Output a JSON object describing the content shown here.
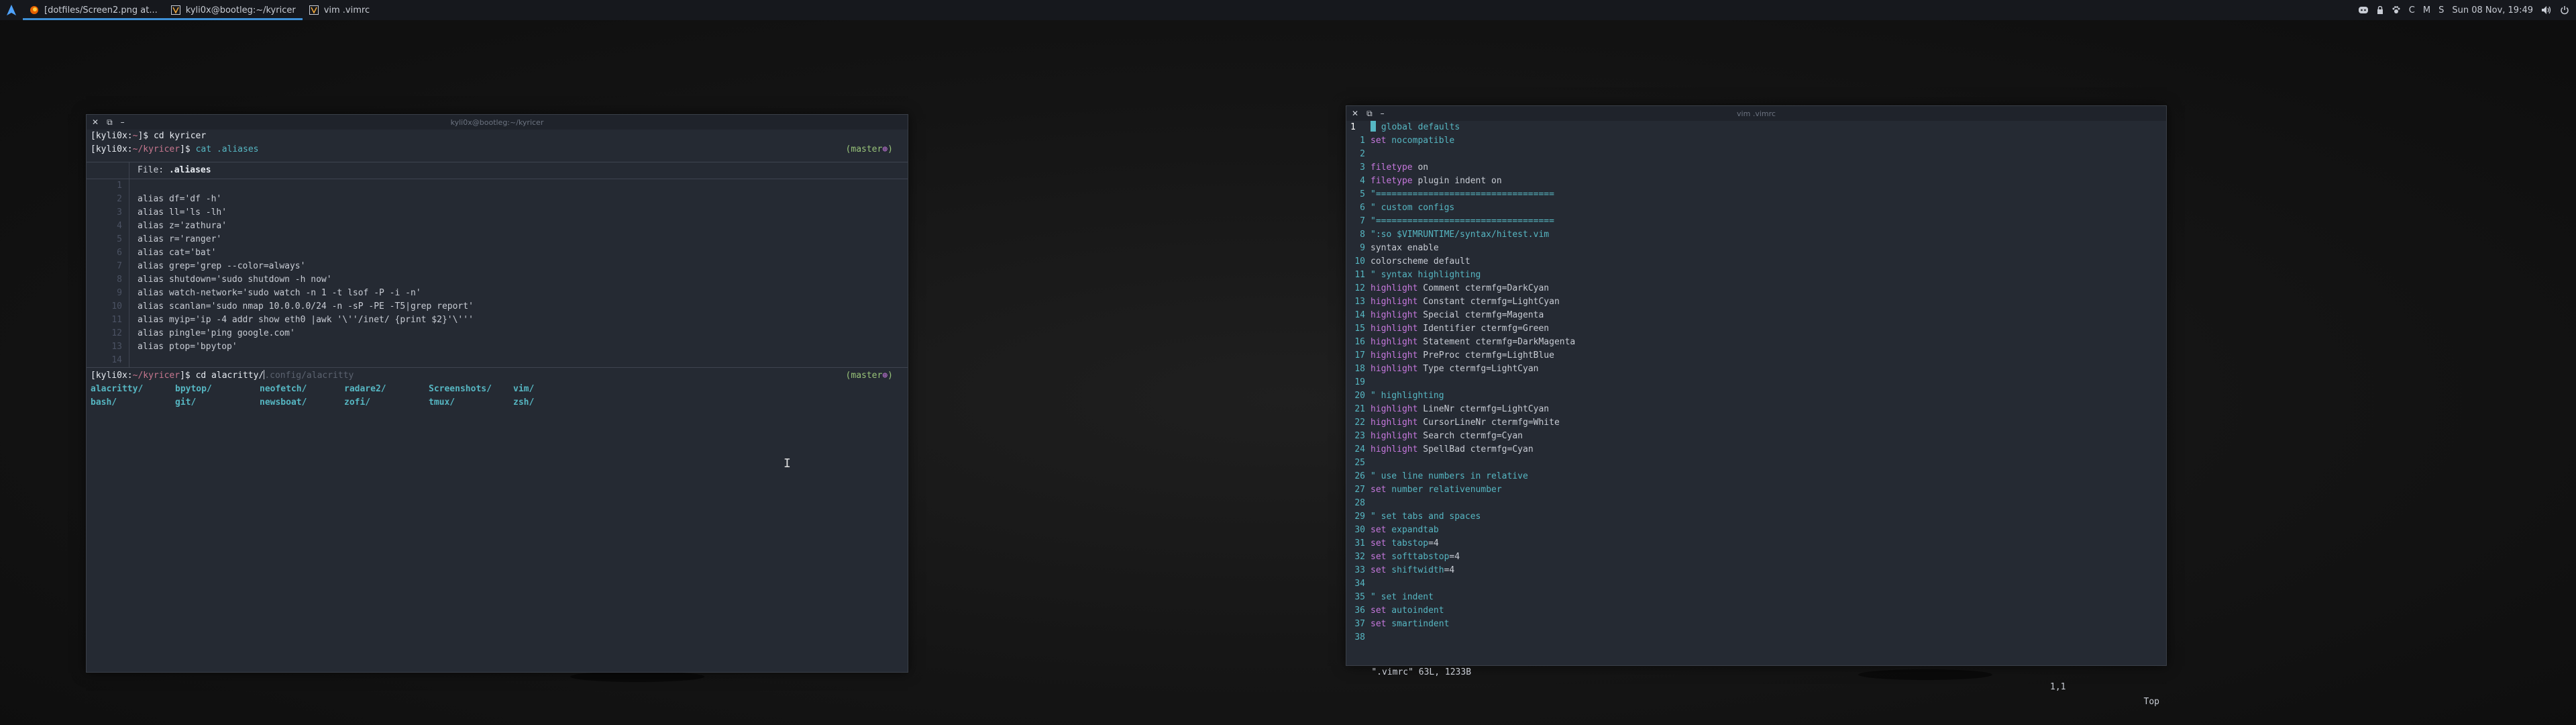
{
  "taskbar": {
    "tasks": [
      {
        "label": "[dotfiles/Screen2.png at...",
        "icon": "firefox-icon",
        "active": true
      },
      {
        "label": "kyli0x@bootleg:~/kyricer",
        "icon": "terminal-icon",
        "active": true
      },
      {
        "label": "vim .vimrc",
        "icon": "terminal-icon",
        "active": false
      }
    ],
    "tray": {
      "letters": [
        "C",
        "M",
        "S"
      ],
      "datetime": "Sun 08 Nov, 19:49"
    }
  },
  "left_terminal": {
    "title": "kyli0x@bootleg:~/kyricer",
    "buttons": [
      "✕",
      "⧉",
      "–"
    ],
    "prompt_user": "[kyli0x:",
    "prompt_tilde": "~",
    "prompt_kyricer": "~/kyricer",
    "prompt_end": "]$ ",
    "cmd1": "cd kyricer",
    "cmd2": "cat .aliases",
    "branch": "(master",
    "branch_mark": "⊕",
    "branch_close": ")",
    "bat_file_label": "File: ",
    "bat_file_name": ".aliases",
    "file_lines": [
      {
        "n": "1",
        "t": ""
      },
      {
        "n": "2",
        "t": "alias df='df -h'"
      },
      {
        "n": "3",
        "t": "alias ll='ls -lh'"
      },
      {
        "n": "4",
        "t": "alias z='zathura'"
      },
      {
        "n": "5",
        "t": "alias r='ranger'"
      },
      {
        "n": "6",
        "t": "alias cat='bat'"
      },
      {
        "n": "7",
        "t": "alias grep='grep --color=always'"
      },
      {
        "n": "8",
        "t": "alias shutdown='sudo shutdown -h now'"
      },
      {
        "n": "9",
        "t": "alias watch-network='sudo watch -n 1 -t lsof -P -i -n'"
      },
      {
        "n": "10",
        "t": "alias scanlan='sudo nmap 10.0.0.0/24 -n -sP -PE -T5|grep report'"
      },
      {
        "n": "11",
        "t": "alias myip='ip -4 addr show eth0 |awk '\\''/inet/ {print $2}'\\'''"
      },
      {
        "n": "12",
        "t": "alias pingle='ping google.com'"
      },
      {
        "n": "13",
        "t": "alias ptop='bpytop'"
      },
      {
        "n": "14",
        "t": ""
      }
    ],
    "cmd3_typed": "cd alacritty/",
    "cmd3_suggest": ".config/alacritty",
    "ls_items": [
      "alacritty/",
      "bpytop/",
      "neofetch/",
      "radare2/",
      "Screenshots/",
      "vim/",
      "bash/",
      "git/",
      "newsboat/",
      "zofi/",
      "tmux/",
      "zsh/"
    ]
  },
  "right_terminal": {
    "title": "vim .vimrc",
    "buttons": [
      "✕",
      "⧉",
      "–"
    ],
    "lines": [
      {
        "n": "1",
        "cur": true,
        "parts": [
          {
            "c": "vc",
            "t": " global defaults"
          }
        ]
      },
      {
        "n": "1",
        "parts": [
          {
            "c": "vk",
            "t": "set"
          },
          {
            "c": "vc",
            "t": " nocompatible"
          }
        ]
      },
      {
        "n": "2",
        "parts": []
      },
      {
        "n": "3",
        "parts": [
          {
            "c": "vk",
            "t": "filetype"
          },
          {
            "c": "",
            "t": " on"
          }
        ]
      },
      {
        "n": "4",
        "parts": [
          {
            "c": "vk",
            "t": "filetype"
          },
          {
            "c": "",
            "t": " plugin indent on"
          }
        ]
      },
      {
        "n": "5",
        "parts": [
          {
            "c": "vc",
            "t": "\"=================================="
          }
        ]
      },
      {
        "n": "6",
        "parts": [
          {
            "c": "vc",
            "t": "\" custom configs"
          }
        ]
      },
      {
        "n": "7",
        "parts": [
          {
            "c": "vc",
            "t": "\"=================================="
          }
        ]
      },
      {
        "n": "8",
        "parts": [
          {
            "c": "vc",
            "t": "\":so $VIMRUNTIME/syntax/hitest.vim"
          }
        ]
      },
      {
        "n": "9",
        "parts": [
          {
            "c": "",
            "t": "syntax enable"
          }
        ]
      },
      {
        "n": "10",
        "parts": [
          {
            "c": "",
            "t": "colorscheme default"
          }
        ]
      },
      {
        "n": "11",
        "parts": [
          {
            "c": "vc",
            "t": "\" syntax highlighting"
          }
        ]
      },
      {
        "n": "12",
        "parts": [
          {
            "c": "vk",
            "t": "highlight"
          },
          {
            "c": "",
            "t": " Comment ctermfg=DarkCyan"
          }
        ]
      },
      {
        "n": "13",
        "parts": [
          {
            "c": "vk",
            "t": "highlight"
          },
          {
            "c": "",
            "t": " Constant ctermfg=LightCyan"
          }
        ]
      },
      {
        "n": "14",
        "parts": [
          {
            "c": "vk",
            "t": "highlight"
          },
          {
            "c": "",
            "t": " Special ctermfg=Magenta"
          }
        ]
      },
      {
        "n": "15",
        "parts": [
          {
            "c": "vk",
            "t": "highlight"
          },
          {
            "c": "",
            "t": " Identifier ctermfg=Green"
          }
        ]
      },
      {
        "n": "16",
        "parts": [
          {
            "c": "vk",
            "t": "highlight"
          },
          {
            "c": "",
            "t": " Statement ctermfg=DarkMagenta"
          }
        ]
      },
      {
        "n": "17",
        "parts": [
          {
            "c": "vk",
            "t": "highlight"
          },
          {
            "c": "",
            "t": " PreProc ctermfg=LightBlue"
          }
        ]
      },
      {
        "n": "18",
        "parts": [
          {
            "c": "vk",
            "t": "highlight"
          },
          {
            "c": "",
            "t": " Type ctermfg=LightCyan"
          }
        ]
      },
      {
        "n": "19",
        "parts": []
      },
      {
        "n": "20",
        "parts": [
          {
            "c": "vc",
            "t": "\" highlighting"
          }
        ]
      },
      {
        "n": "21",
        "parts": [
          {
            "c": "vk",
            "t": "highlight"
          },
          {
            "c": "",
            "t": " LineNr ctermfg=LightCyan"
          }
        ]
      },
      {
        "n": "22",
        "parts": [
          {
            "c": "vk",
            "t": "highlight"
          },
          {
            "c": "",
            "t": " CursorLineNr ctermfg=White"
          }
        ]
      },
      {
        "n": "23",
        "parts": [
          {
            "c": "vk",
            "t": "highlight"
          },
          {
            "c": "",
            "t": " Search ctermfg=Cyan"
          }
        ]
      },
      {
        "n": "24",
        "parts": [
          {
            "c": "vk",
            "t": "highlight"
          },
          {
            "c": "",
            "t": " SpellBad ctermfg=Cyan"
          }
        ]
      },
      {
        "n": "25",
        "parts": []
      },
      {
        "n": "26",
        "parts": [
          {
            "c": "vc",
            "t": "\" use line numbers in relative"
          }
        ]
      },
      {
        "n": "27",
        "parts": [
          {
            "c": "vk",
            "t": "set"
          },
          {
            "c": "vc",
            "t": " number relativenumber"
          }
        ]
      },
      {
        "n": "28",
        "parts": []
      },
      {
        "n": "29",
        "parts": [
          {
            "c": "vc",
            "t": "\" set tabs and spaces"
          }
        ]
      },
      {
        "n": "30",
        "parts": [
          {
            "c": "vk",
            "t": "set"
          },
          {
            "c": "vc",
            "t": " expandtab"
          }
        ]
      },
      {
        "n": "31",
        "parts": [
          {
            "c": "vk",
            "t": "set"
          },
          {
            "c": "vc",
            "t": " tabstop"
          },
          {
            "c": "",
            "t": "=4"
          }
        ]
      },
      {
        "n": "32",
        "parts": [
          {
            "c": "vk",
            "t": "set"
          },
          {
            "c": "vc",
            "t": " softtabstop"
          },
          {
            "c": "",
            "t": "=4"
          }
        ]
      },
      {
        "n": "33",
        "parts": [
          {
            "c": "vk",
            "t": "set"
          },
          {
            "c": "vc",
            "t": " shiftwidth"
          },
          {
            "c": "",
            "t": "=4"
          }
        ]
      },
      {
        "n": "34",
        "parts": []
      },
      {
        "n": "35",
        "parts": [
          {
            "c": "vc",
            "t": "\" set indent"
          }
        ]
      },
      {
        "n": "36",
        "parts": [
          {
            "c": "vk",
            "t": "set"
          },
          {
            "c": "vc",
            "t": " autoindent"
          }
        ]
      },
      {
        "n": "37",
        "parts": [
          {
            "c": "vk",
            "t": "set"
          },
          {
            "c": "vc",
            "t": " smartindent"
          }
        ]
      },
      {
        "n": "38",
        "parts": []
      }
    ],
    "status_file": "\".vimrc\" 63L, 1233B",
    "status_pos": "1,1",
    "status_scroll": "Top"
  }
}
